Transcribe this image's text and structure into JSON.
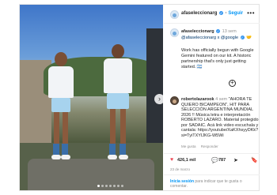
{
  "post": {
    "username": "afaseleccionarg",
    "follow_label": "Seguir",
    "more_label": "•••"
  },
  "caption": {
    "username": "afaseleccionarg",
    "time": "13 sem",
    "line2_a": "@afaseleccionarg",
    "line2_sep": " x ",
    "line2_b": "@google",
    "text": "Work has officially begun with Google Gemini featured on our kit. A historic partnership that's only just getting started. 🇦🇷"
  },
  "comment": {
    "username": "robertolazarook",
    "time": "4 sem",
    "text": "\"AHORA TE QUIERO BICAMPEON\", HIT PARA SELECCIÓN ARGENTINA MUNDIAL 2026 !! Música letra e interpretación ROBERTO LAZARO. Material protegido por SADAIC. Acá link video escuchala y cantala: https://youtube/XaKXhsyyDKk?si=TyiTXYIJKG-W5Wi",
    "like_label": "Me gusta",
    "reply_label": "Responder"
  },
  "actions": {
    "likes": "426,1 mil",
    "comments": "787"
  },
  "date": "23 de marzo",
  "footer": {
    "login_link": "Inicia sesión",
    "login_rest": " para indicar que te gusta o comentar."
  },
  "carousel": {
    "slide_count": 7,
    "active_index": 0
  },
  "icons": {
    "heart": "heart-icon",
    "comment": "comment-bubble-icon",
    "share": "share-icon",
    "bookmark": "bookmark-icon",
    "add": "add-comment-icon",
    "next": "chevron-right-icon"
  },
  "colors": {
    "link": "#0095f6",
    "verified": "#3897f0",
    "heart": "#ed4956"
  }
}
